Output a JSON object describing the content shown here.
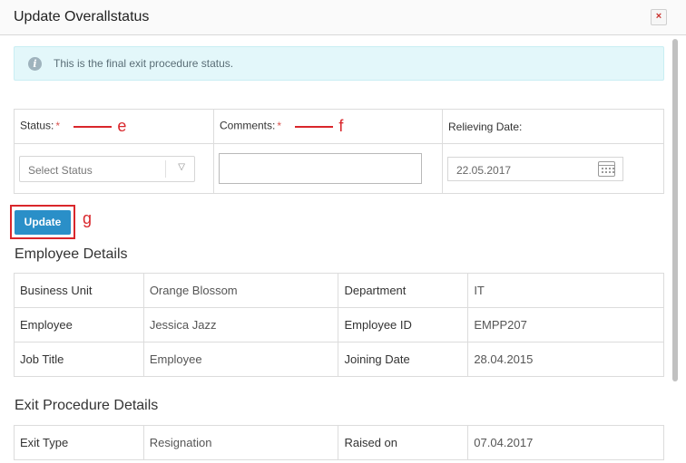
{
  "dialog": {
    "title": "Update Overallstatus",
    "close_label": "×"
  },
  "alert": {
    "message": "This is the final exit procedure status."
  },
  "form": {
    "status_label": "Status:",
    "comments_label": "Comments:",
    "relieving_label": "Relieving Date:",
    "required_mark": "*",
    "status_select": {
      "selected": "Select Status",
      "options": [
        "Select Status"
      ]
    },
    "comments_value": "",
    "relieving_date": "22.05.2017",
    "update_label": "Update"
  },
  "annotations": {
    "status_marker": "e",
    "comments_marker": "f",
    "update_marker": "g",
    "color": "#d9262b"
  },
  "employee_details": {
    "title": "Employee Details",
    "rows": [
      {
        "k1": "Business Unit",
        "v1": "Orange Blossom",
        "k2": "Department",
        "v2": "IT"
      },
      {
        "k1": "Employee",
        "v1": "Jessica Jazz",
        "k2": "Employee ID",
        "v2": "EMPP207"
      },
      {
        "k1": "Job Title",
        "v1": "Employee",
        "k2": "Joining Date",
        "v2": "28.04.2015"
      }
    ]
  },
  "exit_details": {
    "title": "Exit Procedure Details",
    "rows": [
      {
        "k1": "Exit Type",
        "v1": "Resignation",
        "k2": "Raised on",
        "v2": "07.04.2017"
      }
    ]
  },
  "colors": {
    "primary_button": "#2a8fc8",
    "alert_bg": "#e3f7fa",
    "required": "#d9534f"
  },
  "icons": [
    "info-icon",
    "close-icon",
    "chevron-down-icon",
    "calendar-icon"
  ]
}
